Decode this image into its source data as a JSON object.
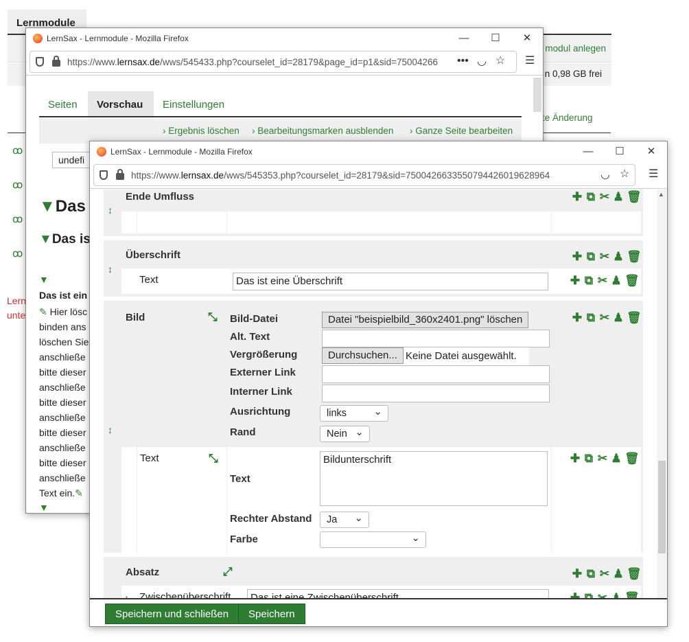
{
  "background": {
    "tab": "Lernmodule",
    "action_right": "modul anlegen",
    "storage": "n 0,98 GB frei",
    "last_change": "te Änderung",
    "left_red_1": "Lern",
    "left_red_2": "unte"
  },
  "window1": {
    "title": "LernSax - Lernmodule - Mozilla Firefox",
    "url_prefix": "https://www.",
    "url_domain": "lernsax.de",
    "url_suffix": "/wws/545433.php?courselet_id=28179&page_id=p1&sid=75004266",
    "tabs": [
      "Seiten",
      "Vorschau",
      "Einstellungen"
    ],
    "actions": [
      "Ergebnis löschen",
      "Bearbeitungsmarken ausblenden",
      "Ganze Seite bearbeiten"
    ],
    "select_value": "undefi",
    "heading1": "Das",
    "heading2": "Das is",
    "body_bold": "Das ist ein",
    "body_lines": [
      "Hier lösc",
      "binden ans",
      "löschen Sie",
      "anschließe",
      "bitte dieser",
      "anschließe",
      "bitte dieser",
      "anschließe",
      "bitte dieser",
      "anschließe",
      "bitte dieser",
      "anschließe",
      "Text ein."
    ]
  },
  "window2": {
    "title": "LernSax - Lernmodule - Mozilla Firefox",
    "url_prefix": "https://www.",
    "url_domain": "lernsax.de",
    "url_suffix": "/wws/545353.php?courselet_id=28179&sid=7500426633550794426019628964",
    "blocks": {
      "ende": "Ende Umfluss",
      "ueberschrift": "Überschrift",
      "text_label": "Text",
      "heading_value": "Das ist eine Überschrift",
      "bild": "Bild",
      "absatz": "Absatz",
      "zwischen": "Zwischenüberschrift",
      "zwischen_value": "Das ist eine Zwischenüberschrift"
    },
    "bild_fields": {
      "datei_label": "Bild-Datei",
      "datei_button": "Datei \"beispielbild_360x2401.png\" löschen",
      "alt_label": "Alt. Text",
      "vergr_label": "Vergrößerung",
      "browse_button": "Durchsuchen...",
      "no_file": "Keine Datei ausgewählt.",
      "extern_label": "Externer Link",
      "intern_label": "Interner Link",
      "ausrichtung_label": "Ausrichtung",
      "ausrichtung_value": "links",
      "rand_label": "Rand",
      "rand_value": "Nein"
    },
    "text_fields": {
      "text_label": "Text",
      "text_value": "Bildunterschrift",
      "abstand_label": "Rechter Abstand",
      "abstand_value": "Ja",
      "farbe_label": "Farbe",
      "farbe_value": ""
    },
    "buttons": {
      "save_close": "Speichern und schließen",
      "save": "Speichern"
    }
  },
  "colors": {
    "accent": "#2e7d32",
    "red": "#d32f2f"
  }
}
